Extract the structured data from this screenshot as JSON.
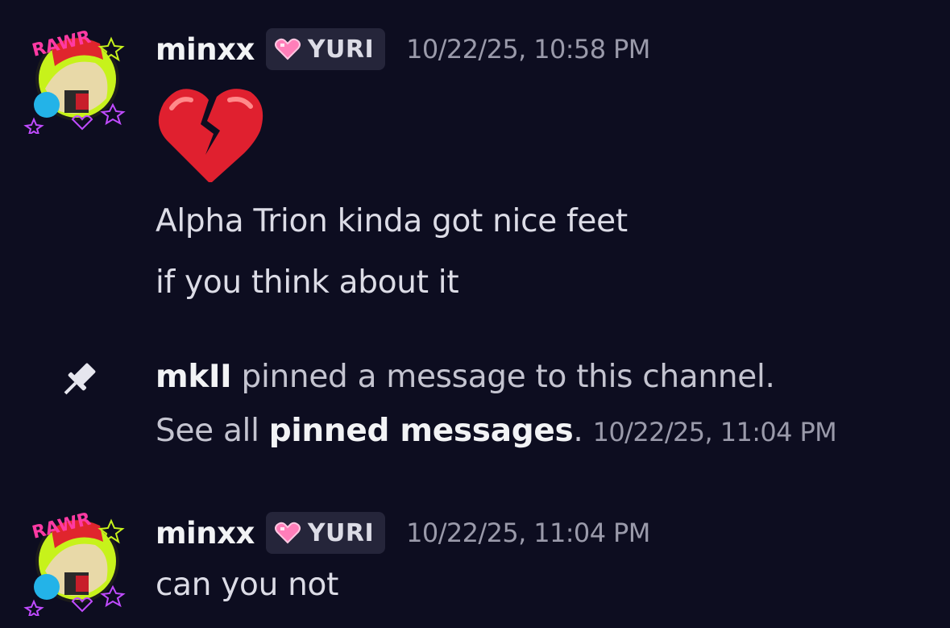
{
  "messages": [
    {
      "username": "minxx",
      "tag": "YURI",
      "timestamp": "10/22/25, 10:58 PM",
      "avatar_text": "RAWR",
      "emoji": "broken-heart",
      "lines": [
        "Alpha Trion kinda got nice feet",
        "if you think about it"
      ]
    },
    {
      "username": "minxx",
      "tag": "YURI",
      "timestamp": "10/22/25, 11:04 PM",
      "avatar_text": "RAWR",
      "lines": [
        "can you not"
      ]
    }
  ],
  "system_message": {
    "actor": "mkII",
    "action_text": " pinned a message to this channel.",
    "see_all_prefix": "See all ",
    "link_text": "pinned messages",
    "suffix": ".",
    "timestamp": "10/22/25, 11:04 PM",
    "icon": "pin-icon"
  },
  "colors": {
    "background": "#0d0d20",
    "tag_background": "#25253a",
    "tag_heart": "#ff7eb9",
    "broken_heart": "#e0202f"
  }
}
